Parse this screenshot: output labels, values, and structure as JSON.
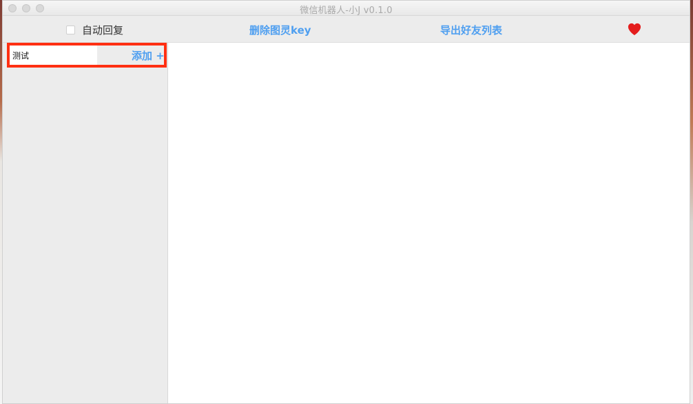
{
  "window": {
    "title": "微信机器人-小J v0.1.0",
    "traffic_lights": [
      "close",
      "minimize",
      "zoom"
    ]
  },
  "toolbar": {
    "auto_reply_label": "自动回复",
    "delete_key_label": "删除图灵key",
    "export_friends_label": "导出好友列表",
    "heart_icon": "heart-icon"
  },
  "sidebar": {
    "input_value": "测试",
    "add_label": "添加 +"
  },
  "colors": {
    "accent": "#4f9ff0",
    "highlight": "#ff2f12",
    "heart": "#e41d1d"
  }
}
